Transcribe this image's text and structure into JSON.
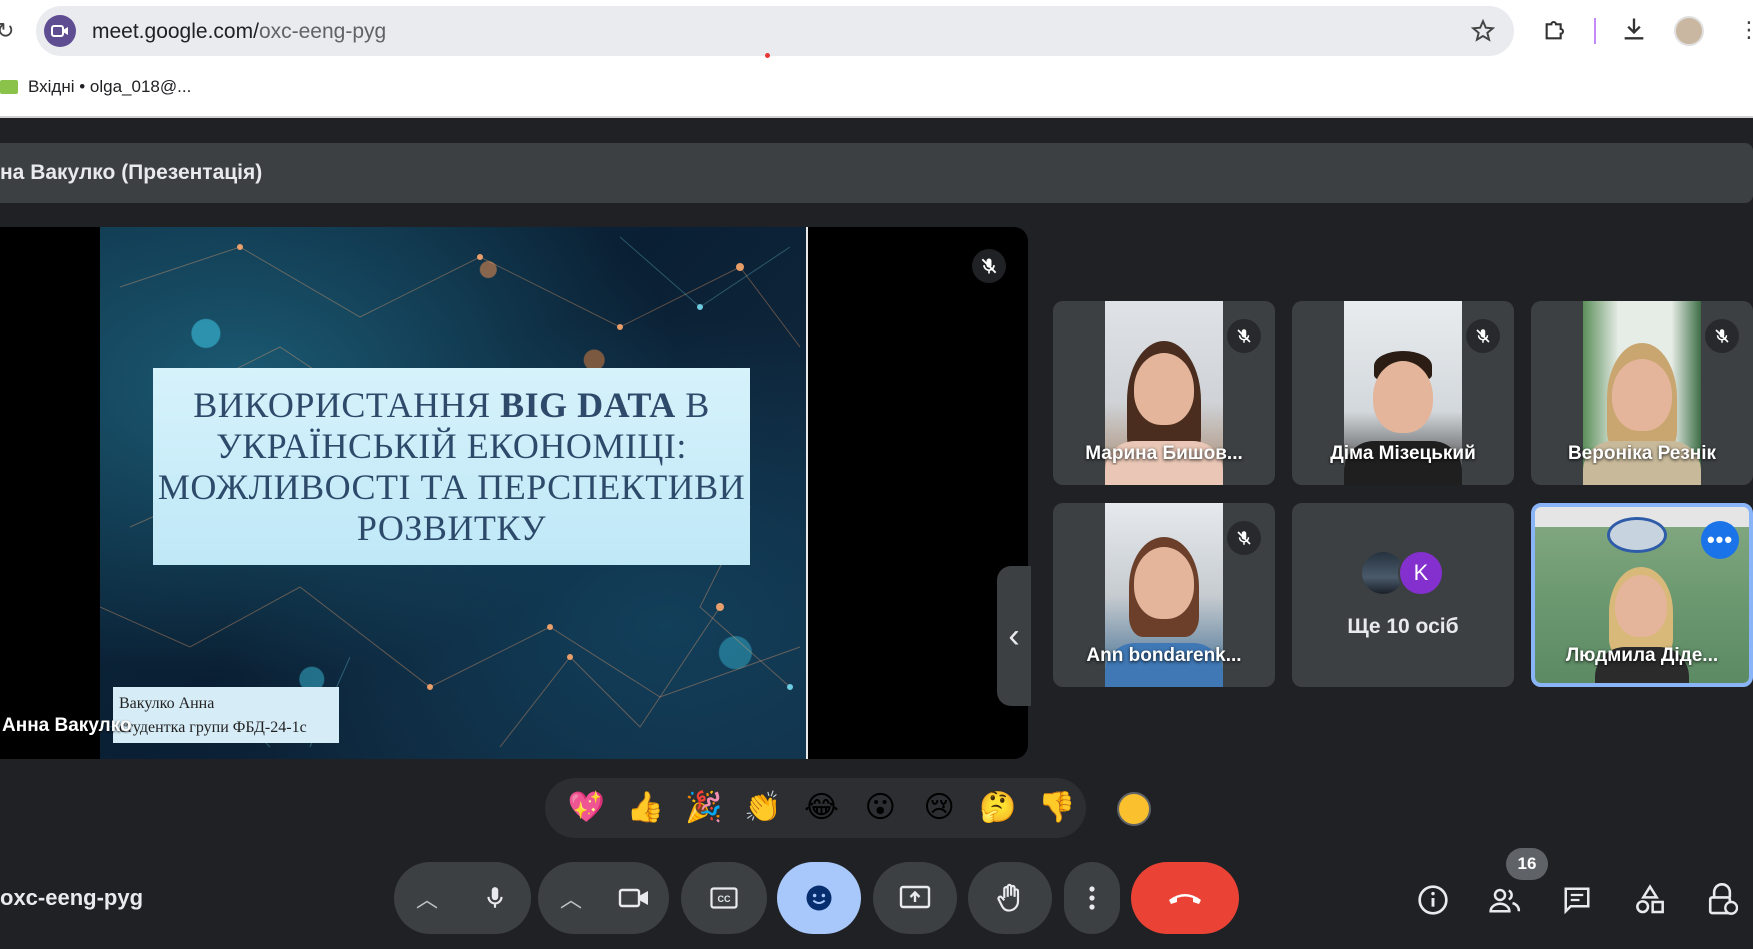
{
  "browser": {
    "url_host": "meet.google.com/",
    "url_path": "oxc-eeng-pyg",
    "bookmark_label": "Вхідні • olga_018@..."
  },
  "presentation": {
    "bar_title": "на Вакулко (Презентація)",
    "presenter_name": "Анна Вакулко",
    "slide_title_part1": "ВИКОРИСТАННЯ ",
    "slide_title_bold": "BIG DATA",
    "slide_title_part2": " В УКРАЇНСЬКІЙ ЕКОНОМІЦІ: МОЖЛИВОСТІ ТА ПЕРСПЕКТИВИ РОЗВИТКУ",
    "slide_author_line1": "Вакулко Анна",
    "slide_author_line2": "студентка групи ФБД-24-1с"
  },
  "participants": [
    {
      "name": "Марина Бишов...",
      "muted": true
    },
    {
      "name": "Діма Мізецький",
      "muted": true
    },
    {
      "name": "Вероніка Резнік",
      "muted": true
    },
    {
      "name": "Ann bondarenk...",
      "muted": true
    },
    {
      "name": "Людмила Діде...",
      "muted": false
    }
  ],
  "more_tile": {
    "avatar_letter": "K",
    "label": "Ще 10 осіб"
  },
  "reactions": [
    "💖",
    "👍",
    "🎉",
    "👏",
    "😂",
    "😮",
    "😢",
    "🤔",
    "👎"
  ],
  "meeting": {
    "code": "oxc-eeng-pyg",
    "participant_count": "16"
  },
  "colors": {
    "end_call": "#ea4335",
    "active_control": "#a8c7fa",
    "active_speaker_border": "#8ab4f8"
  }
}
